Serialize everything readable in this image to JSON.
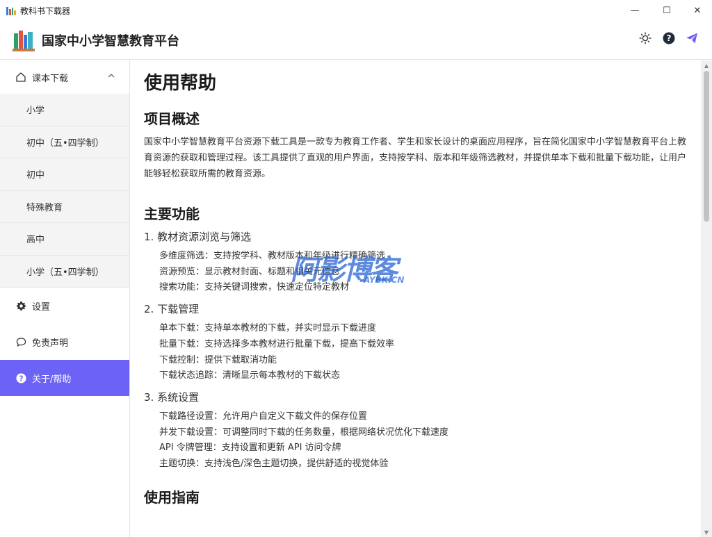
{
  "window": {
    "title": "教科书下载器",
    "minimize_glyph": "—",
    "maximize_glyph": "☐",
    "close_glyph": "✕"
  },
  "header": {
    "brand": "国家中小学智慧教育平台",
    "icons": [
      "theme-sun-icon",
      "help-circle-icon",
      "send-icon"
    ]
  },
  "colors": {
    "accent": "#6c62f5",
    "sidebar_sub_bg": "#f4f4f4",
    "text": "#222222"
  },
  "sidebar": {
    "group_label": "课本下载",
    "sub_items": [
      "小学",
      "初中（五•四学制）",
      "初中",
      "特殊教育",
      "高中",
      "小学（五•四学制）"
    ],
    "settings": "设置",
    "disclaimer": "免责声明",
    "about": "关于/帮助"
  },
  "content": {
    "title": "使用帮助",
    "overview_heading": "项目概述",
    "overview_text": "国家中小学智慧教育平台资源下载工具是一款专为教育工作者、学生和家长设计的桌面应用程序，旨在简化国家中小学智慧教育平台上教育资源的获取和管理过程。该工具提供了直观的用户界面，支持按学科、版本和年级筛选教材，并提供单本下载和批量下载功能，让用户能够轻松获取所需的教育资源。",
    "features_heading": "主要功能",
    "sections": [
      {
        "heading": "1. 教材资源浏览与筛选",
        "items": [
          "多维度筛选：支持按学科、教材版本和年级进行精确筛选",
          "资源预览：显示教材封面、标题和相关元信息",
          "搜索功能：支持关键词搜索，快速定位特定教材"
        ]
      },
      {
        "heading": "2. 下载管理",
        "items": [
          "单本下载：支持单本教材的下载，并实时显示下载进度",
          "批量下载：支持选择多本教材进行批量下载，提高下载效率",
          "下载控制：提供下载取消功能",
          "下载状态追踪：清晰显示每本教材的下载状态"
        ]
      },
      {
        "heading": "3. 系统设置",
        "items": [
          "下载路径设置：允许用户自定义下载文件的保存位置",
          "并发下载设置：可调整同时下载的任务数量，根据网络状况优化下载速度",
          "API 令牌管理：支持设置和更新 API 访问令牌",
          "主题切换：支持浅色/深色主题切换，提供舒适的视觉体验"
        ]
      }
    ],
    "guide_heading": "使用指南"
  },
  "watermark": {
    "main": "阿影博客",
    "sub": "AYBK.CN"
  }
}
